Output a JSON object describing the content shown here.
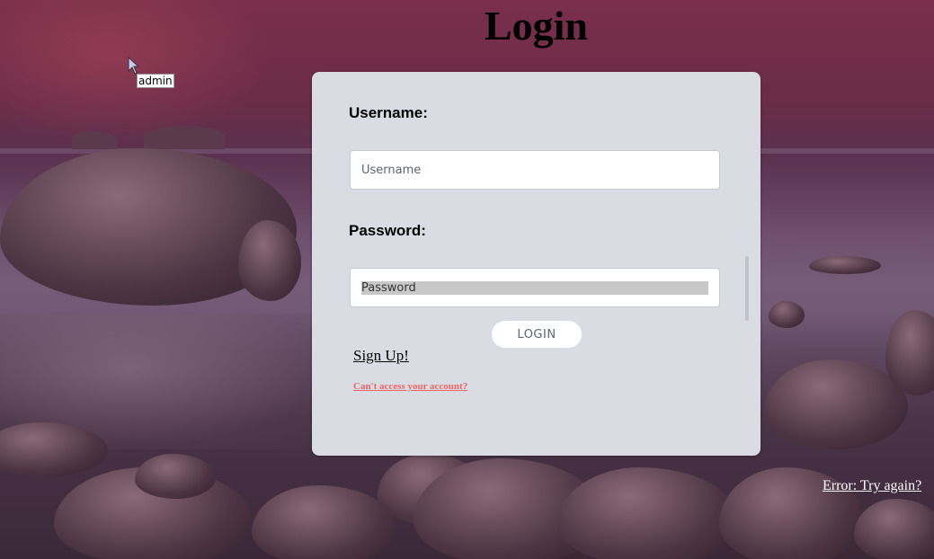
{
  "page": {
    "title": "Login"
  },
  "tooltip": {
    "text": "admin"
  },
  "form": {
    "username_label": "Username:",
    "username_placeholder": "Username",
    "password_label": "Password:",
    "password_placeholder": "Password",
    "login_label": "LOGIN",
    "signup_label": "Sign Up!",
    "forgot_label": "Can't access your account?"
  },
  "error": {
    "text": "Error: Try again?"
  },
  "colors": {
    "card_bg": "#d9dde3",
    "forgot_link": "#f06464",
    "error_link": "#ffffff"
  }
}
